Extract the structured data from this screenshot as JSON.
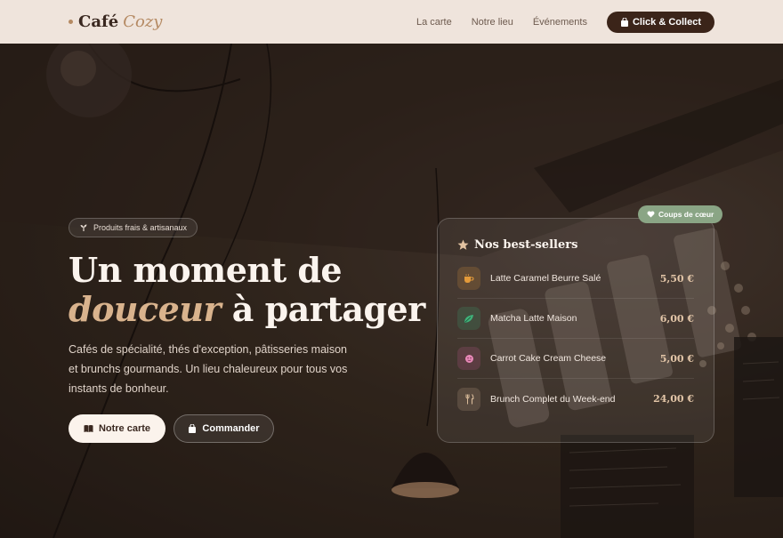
{
  "brand": {
    "name": "Café",
    "accent": "Cozy"
  },
  "nav": {
    "links": [
      "La carte",
      "Notre lieu",
      "Événements"
    ],
    "cta": "Click & Collect"
  },
  "hero": {
    "badge": "Produits frais & artisanaux",
    "title_line1": "Un moment de",
    "title_italic": "douceur",
    "title_rest": " à partager",
    "lead": "Cafés de spécialité, thés d'exception, pâtisseries maison et brunchs gourmands. Un lieu chaleureux pour tous vos instants de bonheur.",
    "primary_button": "Notre carte",
    "secondary_button": "Commander"
  },
  "card": {
    "tag": "Coups de cœur",
    "title": "Nos best-sellers",
    "items": [
      {
        "name": "Latte Caramel Beurre Salé",
        "price": "5,50 €",
        "icon": "coffee-icon"
      },
      {
        "name": "Matcha Latte Maison",
        "price": "6,00 €",
        "icon": "leaf-icon"
      },
      {
        "name": "Carrot Cake Cream Cheese",
        "price": "5,00 €",
        "icon": "cake-icon"
      },
      {
        "name": "Brunch Complet du Week-end",
        "price": "24,00 €",
        "icon": "utensils-icon"
      }
    ]
  },
  "colors": {
    "accent": "#b58a63",
    "cta": "#3b2419",
    "tag": "#8aa585",
    "nav_bg": "#efe4dc"
  }
}
